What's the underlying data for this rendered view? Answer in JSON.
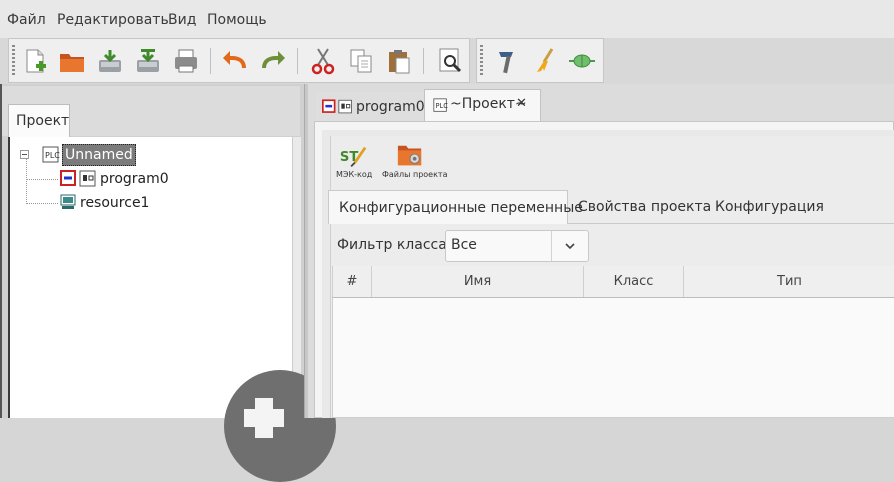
{
  "menubar": {
    "items": [
      {
        "label": "Файл"
      },
      {
        "label": "Редактировать"
      },
      {
        "label": "Вид"
      },
      {
        "label": "Помощь"
      }
    ]
  },
  "toolbar": {
    "buttons": [
      {
        "icon": "new-file-icon"
      },
      {
        "icon": "open-folder-icon"
      },
      {
        "icon": "save-icon"
      },
      {
        "icon": "save-as-icon"
      },
      {
        "icon": "print-icon"
      },
      {
        "icon": "undo-icon"
      },
      {
        "icon": "redo-icon"
      },
      {
        "icon": "cut-icon"
      },
      {
        "icon": "copy-icon"
      },
      {
        "icon": "paste-icon"
      },
      {
        "icon": "find-icon"
      },
      {
        "icon": "build-hammer-icon"
      },
      {
        "icon": "clean-brush-icon"
      },
      {
        "icon": "connect-icon"
      }
    ]
  },
  "left_panel": {
    "tab_label": "Проект",
    "tree": {
      "root_label": "Unnamed",
      "children": [
        {
          "label": "program0",
          "icon": "program-icon"
        },
        {
          "label": "resource1",
          "icon": "resource-icon"
        }
      ]
    }
  },
  "editor_tabs": [
    {
      "label": "program0"
    },
    {
      "label": "~Проект~",
      "close": "✕"
    }
  ],
  "project_panel": {
    "buttons": [
      {
        "label": "МЭК-код",
        "icon": "st-code-icon"
      },
      {
        "label": "Файлы проекта",
        "icon": "project-files-icon"
      }
    ],
    "tabs": [
      {
        "label": "Конфигурационные переменные"
      },
      {
        "label": "Свойства проекта"
      },
      {
        "label": "Конфигурация"
      }
    ],
    "filter": {
      "label": "Фильтр класса:",
      "value": "Все"
    },
    "table": {
      "columns": [
        "#",
        "Имя",
        "Класс",
        "Тип"
      ],
      "rows": []
    }
  },
  "colors": {
    "accent_red": "#d33",
    "undo_orange": "#e06a1a",
    "redo_green": "#6e8f3a",
    "selected_bg": "#7b7b7b"
  }
}
